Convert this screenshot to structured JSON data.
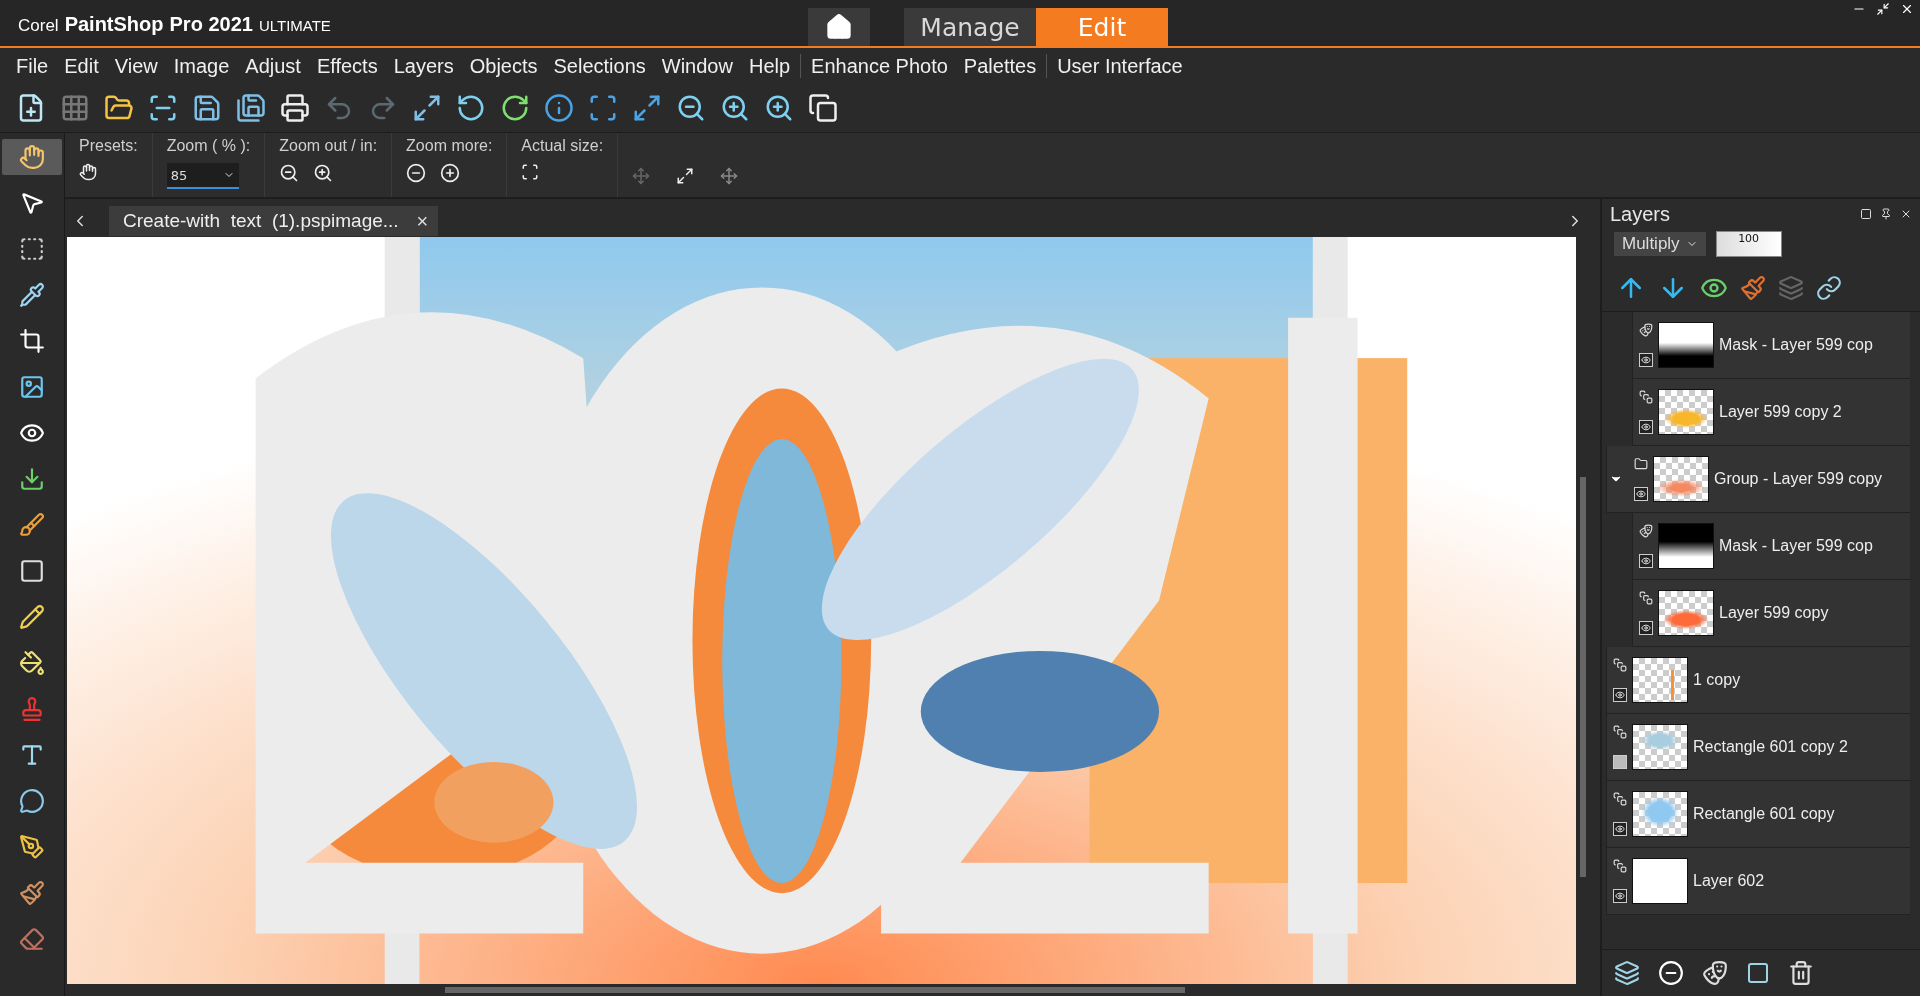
{
  "title_bar": {
    "brand": "Corel",
    "product": "PaintShop",
    "version": "Pro 2021",
    "edition": "ULTIMATE"
  },
  "workspace_tabs": [
    {
      "label": "Manage",
      "selected": false
    },
    {
      "label": "Edit",
      "selected": true
    }
  ],
  "menu": [
    "File",
    "Edit",
    "View",
    "Image",
    "Adjust",
    "Effects",
    "Layers",
    "Objects",
    "Selections",
    "Window",
    "Help"
  ],
  "menu_extra": [
    "Enhance Photo",
    "Palettes",
    "User Interface"
  ],
  "tools": [
    {
      "kind": "pan",
      "selected": true
    },
    {
      "kind": "pick",
      "selected": false
    },
    {
      "kind": "selection",
      "selected": false
    },
    {
      "kind": "dropper",
      "selected": false
    },
    {
      "kind": "crop",
      "selected": false
    },
    {
      "kind": "straighten",
      "selected": false
    },
    {
      "kind": "red-eye",
      "selected": false
    },
    {
      "kind": "import",
      "selected": false
    },
    {
      "kind": "brush",
      "selected": false
    },
    {
      "kind": "gradient",
      "selected": false
    },
    {
      "kind": "pencil",
      "selected": false
    },
    {
      "kind": "fill",
      "selected": false
    },
    {
      "kind": "stamp",
      "selected": false
    },
    {
      "kind": "text",
      "selected": false
    },
    {
      "kind": "shape",
      "selected": false
    },
    {
      "kind": "pen",
      "selected": false
    },
    {
      "kind": "art-brush",
      "selected": false
    },
    {
      "kind": "eraser",
      "selected": false
    }
  ],
  "options_bar": {
    "presets_label": "Presets:",
    "zoom_label": "Zoom ( % ):",
    "zoom_value": "85",
    "zoom_in_out_label": "Zoom out / in:",
    "zoom_more_label": "Zoom more:",
    "actual_size_label": "Actual size:"
  },
  "document_tab": {
    "title": "Create-with  text  (1).pspimage...",
    "close": "×"
  },
  "layers_panel": {
    "title": "Layers",
    "blend_mode": "Multiply",
    "opacity": "100",
    "continued_group_children": [
      {
        "name": "Mask - Layer 599 cop",
        "kind": "mask",
        "thumbnail": {
          "kind": "white-to-black"
        },
        "visible": true
      },
      {
        "name": "Layer 599 copy 2",
        "kind": "raster",
        "thumbnail": {
          "kind": "yellow-blob"
        },
        "visible": true
      }
    ],
    "layers": [
      {
        "name": "Group - Layer 599 copy",
        "kind": "group",
        "thumbnail": {
          "kind": "orange-soft"
        },
        "visible": true,
        "expanded": true,
        "children": [
          {
            "name": "Mask - Layer 599 cop",
            "kind": "mask",
            "thumbnail": {
              "kind": "black-to-white"
            },
            "visible": true
          },
          {
            "name": "Layer 599 copy",
            "kind": "raster",
            "thumbnail": {
              "kind": "orange-blob"
            },
            "visible": true
          }
        ]
      },
      {
        "name": "1 copy",
        "kind": "raster",
        "thumbnail": {
          "kind": "digit"
        },
        "visible": true
      },
      {
        "name": "Rectangle 601 copy 2",
        "kind": "raster",
        "thumbnail": {
          "kind": "blue-soft"
        },
        "visible": false
      },
      {
        "name": "Rectangle 601 copy",
        "kind": "raster",
        "thumbnail": {
          "kind": "blue-blob"
        },
        "visible": true
      },
      {
        "name": "Layer 602",
        "kind": "raster",
        "thumbnail": {
          "kind": "white"
        },
        "visible": true
      }
    ]
  }
}
